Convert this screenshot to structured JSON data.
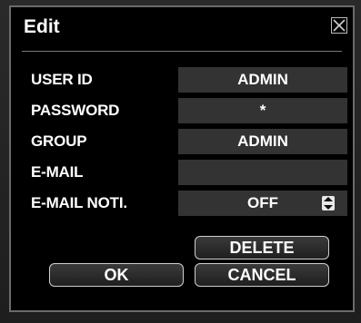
{
  "dialog": {
    "title": "Edit",
    "close_icon": "close-icon"
  },
  "fields": [
    {
      "label": "USER ID",
      "value": "ADMIN"
    },
    {
      "label": "PASSWORD",
      "value": "*"
    },
    {
      "label": "GROUP",
      "value": "ADMIN"
    },
    {
      "label": "E-MAIL",
      "value": ""
    },
    {
      "label": "E-MAIL NOTI.",
      "value": "OFF"
    }
  ],
  "buttons": {
    "delete": "DELETE",
    "ok": "OK",
    "cancel": "CANCEL"
  },
  "icons": {
    "stepper": "updown-stepper-icon"
  },
  "colors": {
    "background": "#000000",
    "field": "#333333",
    "text": "#ffffff",
    "border": "#6b6b6b"
  }
}
